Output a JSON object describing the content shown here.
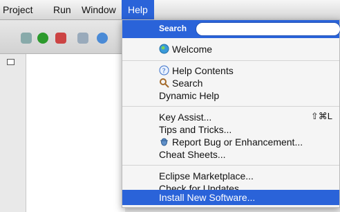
{
  "menubar": {
    "items": [
      {
        "label": "Project"
      },
      {
        "label": "Run"
      },
      {
        "label": "Window"
      },
      {
        "label": "Help"
      }
    ]
  },
  "help_menu": {
    "search_label": "Search",
    "search_value": "",
    "groups": [
      [
        {
          "label": "Welcome",
          "icon": "welcome-globe-icon"
        }
      ],
      [
        {
          "label": "Help Contents",
          "icon": "help-question-icon"
        },
        {
          "label": "Search",
          "icon": "search-magnifier-icon"
        },
        {
          "label": "Dynamic Help",
          "icon": ""
        }
      ],
      [
        {
          "label": "Key Assist...",
          "shortcut": "⇧⌘L"
        },
        {
          "label": "Tips and Tricks..."
        },
        {
          "label": "Report Bug or Enhancement...",
          "icon": "bug-report-icon"
        },
        {
          "label": "Cheat Sheets..."
        }
      ],
      [
        {
          "label": "Eclipse Marketplace..."
        },
        {
          "label": "Check for Updates"
        },
        {
          "label": "Install New Software...",
          "selected": true
        }
      ]
    ]
  },
  "colors": {
    "accent": "#2a63d9",
    "menu_bg": "#f5f5f5"
  }
}
